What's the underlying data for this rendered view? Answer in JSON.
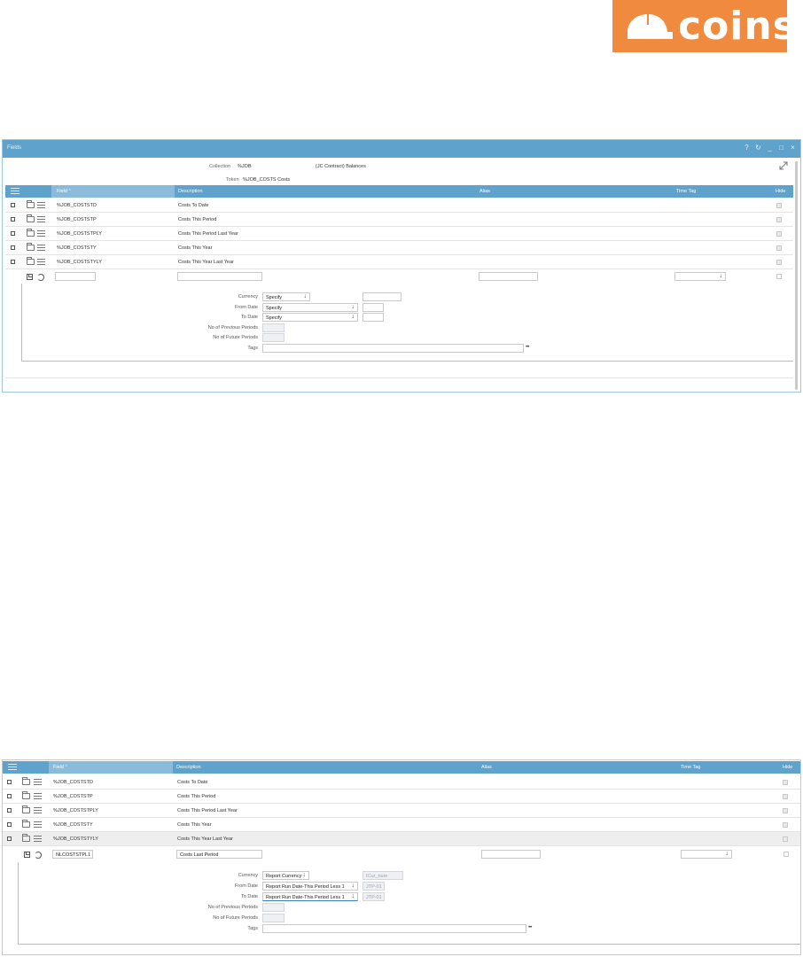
{
  "logo": {
    "text": "coins",
    "color": "#ef8a3e"
  },
  "colors": {
    "header_blue": "#5fa2cc",
    "sorted_col": "#8bbbdb"
  },
  "panel1": {
    "title": "Fields",
    "window_controls": [
      "help-icon",
      "refresh-icon",
      "minimize-icon",
      "maximize-icon",
      "close-icon"
    ],
    "collection_label": "Collection",
    "collection_value": "%JOB",
    "collection_desc": "(JC Contract) Balances",
    "token_label": "Token",
    "token_value": "%JOB_COSTS Costs",
    "columns": {
      "field": "Field",
      "sort_indicator": "^",
      "description": "Description",
      "alias": "Alias",
      "time_tag": "Time Tag",
      "hide": "Hide"
    },
    "rows": [
      {
        "field": "%JOB_COSTSTD",
        "description": "Costs To Date"
      },
      {
        "field": "%JOB_COSTSTP",
        "description": "Costs This Period"
      },
      {
        "field": "%JOB_COSTSTPLY",
        "description": "Costs This Period Last Year"
      },
      {
        "field": "%JOB_COSTSTY",
        "description": "Costs This Year"
      },
      {
        "field": "%JOB_COSTSTYLY",
        "description": "Costs This Year Last Year"
      }
    ],
    "new_row": {
      "field": "",
      "description": "",
      "alias": "",
      "time_tag": ""
    },
    "detail": {
      "currency_label": "Currency",
      "currency_value": "Specify",
      "currency_extra": "",
      "from_label": "From Date",
      "from_value": "Specify",
      "from_extra": "",
      "to_label": "To Date",
      "to_value": "Specify",
      "to_extra": "",
      "prev_label": "No of Previous Periods",
      "future_label": "No of Future Periods",
      "tags_label": "Tags",
      "tags_value": "",
      "more": "•••"
    }
  },
  "panel2": {
    "columns": {
      "field": "Field",
      "sort_indicator": "^",
      "description": "Description",
      "alias": "Alias",
      "time_tag": "Time Tag",
      "hide": "Hide"
    },
    "rows": [
      {
        "field": "%JOB_COSTSTD",
        "description": "Costs To Date"
      },
      {
        "field": "%JOB_COSTSTP",
        "description": "Costs This Period"
      },
      {
        "field": "%JOB_COSTSTPLY",
        "description": "Costs This Period Last Year"
      },
      {
        "field": "%JOB_COSTSTY",
        "description": "Costs This Year"
      },
      {
        "field": "%JOB_COSTSTYLY",
        "description": "Costs This Year Last Year"
      }
    ],
    "new_row": {
      "field": "NLCOSTSTPL1",
      "description": "Costs Last Period",
      "alias": "",
      "time_tag": ""
    },
    "detail": {
      "currency_label": "Currency",
      "currency_value": "Report Currency",
      "currency_extra": "ICur_num",
      "from_label": "From Date",
      "from_value": "Report Run Date-This Period Less 1",
      "from_extra": "JTP-01",
      "to_label": "To Date",
      "to_value": "Report Run Date-This Period Less 1",
      "to_extra": "JTP-01",
      "prev_label": "No of Previous Periods",
      "future_label": "No of Future Periods",
      "tags_label": "Tags",
      "tags_value": "",
      "more": "•••"
    }
  }
}
